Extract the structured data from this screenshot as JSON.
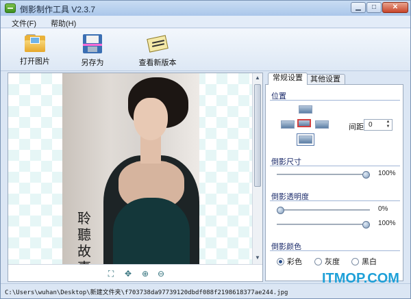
{
  "window": {
    "title": "倒影制作工具 V2.3.7",
    "controls": {
      "minimize": "▁",
      "maximize": "□",
      "close": "✕"
    }
  },
  "menu": {
    "file": "文件(F)",
    "help": "帮助(H)"
  },
  "toolbar": {
    "open_label": "打开图片",
    "save_label": "另存为",
    "update_label": "查看新版本"
  },
  "image_view": {
    "calligraphy": "聆 聽 故 事",
    "zoom_icons": [
      "fit-icon",
      "actual-size-icon",
      "zoom-in-icon",
      "zoom-out-icon"
    ]
  },
  "settings": {
    "tabs": {
      "general": "常规设置",
      "other": "其他设置"
    },
    "position": {
      "title": "位置",
      "spacing_label": "间距",
      "spacing_value": "0"
    },
    "size": {
      "title": "倒影尺寸",
      "value": "100%",
      "level": 1.0
    },
    "opacity": {
      "title": "倒影透明度",
      "start_value": "0%",
      "start_level": 0.0,
      "end_value": "100%",
      "end_level": 1.0
    },
    "color": {
      "title": "倒影颜色",
      "options": [
        "彩色",
        "灰度",
        "黑白"
      ],
      "selected": "彩色"
    }
  },
  "status": {
    "path": "C:\\Users\\wuhan\\Desktop\\新建文件夹\\f703738da97739120dbdf088f2198618377ae244.jpg"
  },
  "watermark": "ITMOP.COM",
  "colors": {
    "accent": "#1ea0d8",
    "title_bar": "#aac6ea",
    "close_button": "#c8452a"
  }
}
